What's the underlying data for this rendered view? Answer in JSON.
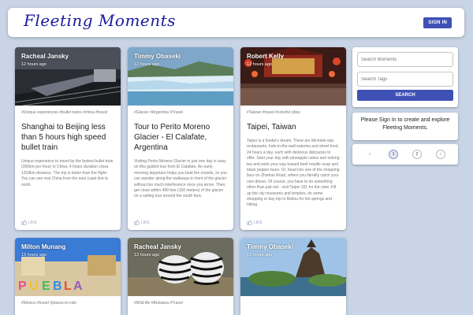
{
  "app": {
    "logo": "Fleeting Moments",
    "signin_label": "SIGN IN"
  },
  "posts": [
    {
      "author": "Racheal Jansky",
      "time": "12 hours ago",
      "tags": "#Unique experiences #bullet trains #china #travel",
      "title": "Shanghai to Beijing less than 5 hours high speed bullet train",
      "message": "Unique experience to travel by the fastest bullet train (350km per hour) in China, 4 hours duration cross 1318km distance. The trip is faster than the flight. You can see real China from the east coast line to north.",
      "like_label": "LIKE"
    },
    {
      "author": "Timmy Obaseki",
      "time": "12 hours ago",
      "tags": "#Glacier #Argentina #Travel",
      "title": "Tour to Perito Moreno Glacier - El Calafate, Argentina",
      "message": "Visiting Perito Moreno Glacier in just one day is easy on this guided tour from El Calafate. An early-morning departure helps you beat the crowds, so you can wander along the walkways in front of the glacier without too much interference once you arrive. Then, get close within 490 feet (150 meters) of the glacier on a sailing tour around the south face.",
      "like_label": "LIKE"
    },
    {
      "author": "Robert Kelly",
      "time": "12 hours ago",
      "tags": "#Taiwan #travel #colorful cities",
      "title": "Taipei, Taiwan",
      "message": "Taipei is a foodie's dream. There are Michelin-star restaurants, hole-in-the-wall eateries and street food 24 hours a day, each with delicious delicacies to offer. Start your day with pineapple cakes and oolong tea and work your way toward beef noodle soup and black pepper buns. Or, head into one of the shopping bars on Zhishan Road, where you literally catch your own dinner. Of course, you have to do something other than just eat - visit Taipei 101 for the view. Fill up the city museums and temples, do some shopping or day trip to Beitou for hot springs and hiking.",
      "like_label": "LIKE"
    },
    {
      "author": "Milton Munang",
      "time": "13 hours ago",
      "tags": "#Mexico #travel #places-to-visit",
      "title": "",
      "message": "",
      "like_label": ""
    },
    {
      "author": "Racheal Jansky",
      "time": "13 hours ago",
      "tags": "#Wild life #Botwana #Travel",
      "title": "",
      "message": "",
      "like_label": ""
    },
    {
      "author": "Timmy Obaseki",
      "time": "13 hours ago",
      "tags": "",
      "title": "",
      "message": "",
      "like_label": ""
    }
  ],
  "search": {
    "memories_placeholder": "Search Moments",
    "tags_placeholder": "Search Tags",
    "button_label": "SEARCH"
  },
  "signin_prompt": "Please Sign In to create and explore Fleeting Moments.",
  "pagination": {
    "prev": "‹",
    "pages": [
      "1",
      "2"
    ],
    "active": "1",
    "next": "›"
  },
  "icons": {
    "like": "thumb-up-icon",
    "prev": "chevron-left-icon",
    "next": "chevron-right-icon"
  },
  "colors": {
    "accent": "#3f51b5",
    "background": "#c9d5e6"
  }
}
